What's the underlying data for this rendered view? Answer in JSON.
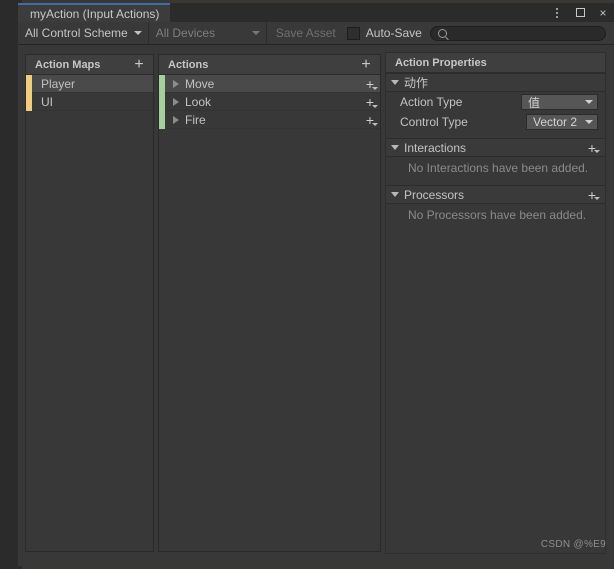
{
  "window": {
    "tab_title": "myAction (Input Actions)",
    "controls": {
      "menu": "kebab-menu-icon",
      "maximize": "maximize-icon",
      "close": "×"
    }
  },
  "toolbar": {
    "control_scheme": "All Control Scheme",
    "devices": "All Devices",
    "save_asset": "Save Asset",
    "auto_save": "Auto-Save",
    "auto_save_checked": false,
    "search_value": "",
    "search_placeholder": ""
  },
  "action_maps": {
    "header": "Action Maps",
    "add_label": "+",
    "accent_color": "#f0cd7e",
    "items": [
      {
        "label": "Player",
        "selected": true
      },
      {
        "label": "UI",
        "selected": false
      }
    ]
  },
  "actions": {
    "header": "Actions",
    "add_label": "+",
    "accent_color": "#a7cf9c",
    "items": [
      {
        "label": "Move",
        "selected": true
      },
      {
        "label": "Look",
        "selected": false
      },
      {
        "label": "Fire",
        "selected": false
      }
    ]
  },
  "properties": {
    "header": "Action Properties",
    "action_section": {
      "title": "动作",
      "rows": [
        {
          "label": "Action Type",
          "value": "值"
        },
        {
          "label": "Control Type",
          "value": "Vector 2"
        }
      ]
    },
    "interactions": {
      "title": "Interactions",
      "empty": "No Interactions have been added."
    },
    "processors": {
      "title": "Processors",
      "empty": "No Processors have been added."
    }
  },
  "watermark": "CSDN @%E9"
}
